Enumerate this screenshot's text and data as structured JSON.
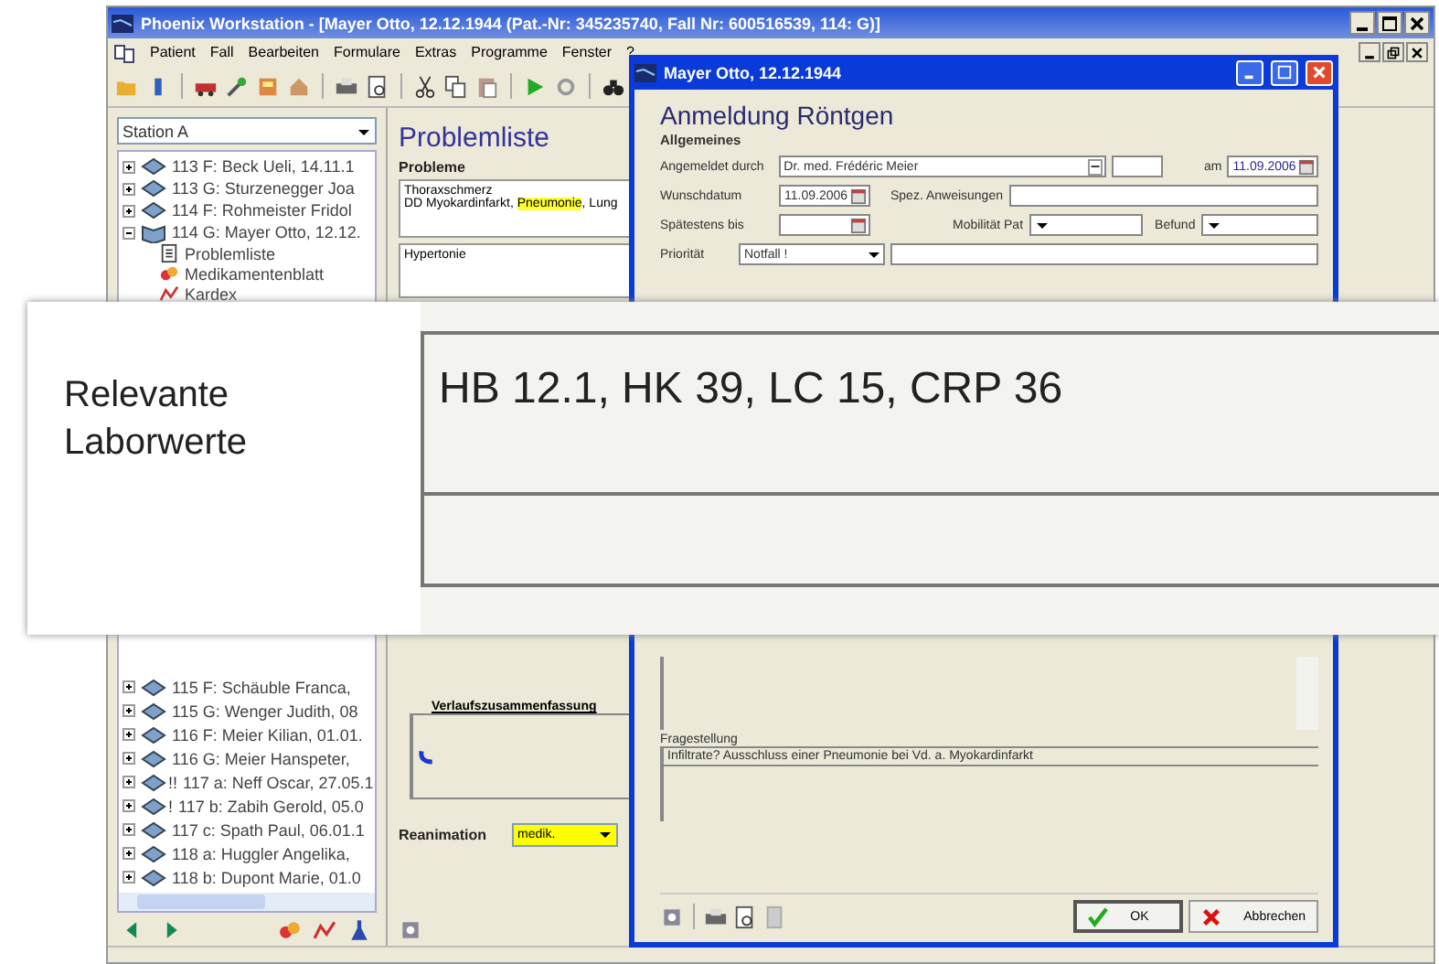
{
  "window": {
    "title": "Phoenix Workstation - [Mayer Otto, 12.12.1944 (Pat.-Nr: 345235740, Fall Nr: 600516539, 114: G)]",
    "menu": [
      "Patient",
      "Fall",
      "Bearbeiten",
      "Formulare",
      "Extras",
      "Programme",
      "Fenster",
      "?"
    ]
  },
  "sidebar": {
    "station": "Station A",
    "tree_upper": [
      {
        "label": "113 F: Beck Ueli, 14.11.1",
        "expanded": false
      },
      {
        "label": "113 G: Sturzenegger Joa",
        "expanded": false
      },
      {
        "label": "114 F: Rohmeister Fridol",
        "expanded": false
      },
      {
        "label": "114 G: Mayer Otto, 12.12.",
        "expanded": true,
        "children": [
          {
            "label": "Problemliste",
            "kind": "page"
          },
          {
            "label": "Medikamentenblatt",
            "kind": "pills"
          },
          {
            "label": "Kardex",
            "kind": "chart"
          }
        ]
      }
    ],
    "tree_lower": [
      {
        "label": "115 F: Schäuble Franca,",
        "expanded": false
      },
      {
        "label": "115 G: Wenger Judith, 08",
        "expanded": false
      },
      {
        "label": "116 F: Meier Kilian, 01.01.",
        "expanded": false
      },
      {
        "label": "116 G: Meier Hanspeter,",
        "expanded": false
      },
      {
        "label": "117 a: Neff Oscar, 27.05.1",
        "expanded": false,
        "flag": "!!"
      },
      {
        "label": "117 b: Zabih Gerold, 05.0",
        "expanded": false,
        "flag": "!"
      },
      {
        "label": "117 c: Spath Paul, 06.01.1",
        "expanded": false
      },
      {
        "label": "118 a: Huggler Angelika,",
        "expanded": false
      },
      {
        "label": "118 b: Dupont Marie, 01.0",
        "expanded": false
      }
    ]
  },
  "problem_panel": {
    "title": "Problemliste",
    "problems_label": "Probleme",
    "problems_lines": [
      [
        {
          "text": "Thoraxschmerz",
          "highlighted": false
        }
      ],
      [
        {
          "text": "DD Myokardinfarkt, ",
          "highlighted": false
        },
        {
          "text": "Pneumonie",
          "highlighted": true
        },
        {
          "text": ", Lung",
          "highlighted": false
        }
      ]
    ],
    "second_box": "Hypertonie",
    "summary_label": "Verlaufszusammenfassung",
    "reanimation_label": "Reanimation",
    "reanimation_value": "medik."
  },
  "dialog": {
    "title": "Mayer Otto, 12.12.1944",
    "heading": "Anmeldung Röntgen",
    "section": "Allgemeines",
    "requested_by_label": "Angemeldet durch",
    "requested_by": "Dr. med. Frédéric Meier",
    "on_label": "am",
    "on_date": "11.09.2006",
    "wish_date_label": "Wunschdatum",
    "wish_date": "11.09.2006",
    "instructions_label": "Spez. Anweisungen",
    "latest_label": "Spätestens bis",
    "mobility_label": "Mobilität Pat",
    "finding_label": "Befund",
    "priority_label": "Priorität",
    "priority": "Notfall !",
    "question_label": "Fragestellung",
    "question": "Infiltrate? Ausschluss einer Pneumonie bei Vd. a. Myokardinfarkt",
    "buttons": [
      {
        "label": "OK",
        "kind": "ok"
      },
      {
        "label": "Abbrechen",
        "kind": "cancel"
      }
    ]
  },
  "magnifier": {
    "label_lines": [
      "Relevante",
      "Laborwerte"
    ],
    "value": "HB 12.1, HK 39, LC 15, CRP 36"
  }
}
